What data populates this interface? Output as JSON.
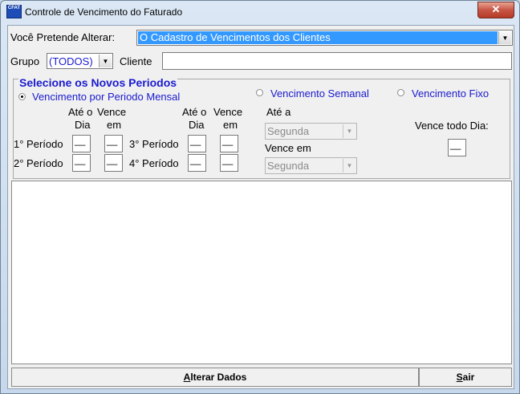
{
  "window": {
    "title": "Controle de Vencimento do Faturado",
    "icon_text": "CFAT",
    "close_label": "✕"
  },
  "filters": {
    "alterar_label": "Você Pretende Alterar:",
    "alterar_value": "O Cadastro de Vencimentos dos Clientes",
    "grupo_label": "Grupo",
    "grupo_value": "(TODOS)",
    "cliente_label": "Cliente",
    "cliente_value": ""
  },
  "periods": {
    "section_title": "Selecione os Novos Periodos",
    "option_mensal": "Vencimento por Periodo Mensal",
    "option_semanal": "Vencimento Semanal",
    "option_fixo": "Vencimento Fixo",
    "selected_option": "mensal",
    "col_ate_o": "Até o",
    "col_dia": "Dia",
    "col_vence": "Vence",
    "col_em": "em",
    "rows": [
      {
        "label": "1° Período",
        "ate": "__",
        "vence": "__"
      },
      {
        "label": "2° Período",
        "ate": "__",
        "vence": "__"
      },
      {
        "label": "3° Período",
        "ate": "__",
        "vence": "__"
      },
      {
        "label": "4° Período",
        "ate": "__",
        "vence": "__"
      }
    ],
    "semanal_ate_label": "Até a",
    "semanal_ate_value": "Segunda",
    "semanal_vence_label": "Vence em",
    "semanal_vence_value": "Segunda",
    "fixo_label": "Vence todo Dia:",
    "fixo_value": "__"
  },
  "buttons": {
    "alterar_prefix": "A",
    "alterar_rest": "lterar Dados",
    "sair_prefix": "S",
    "sair_rest": "air"
  },
  "colors": {
    "selection": "#3399ff",
    "section_title": "#1a1ad0"
  }
}
